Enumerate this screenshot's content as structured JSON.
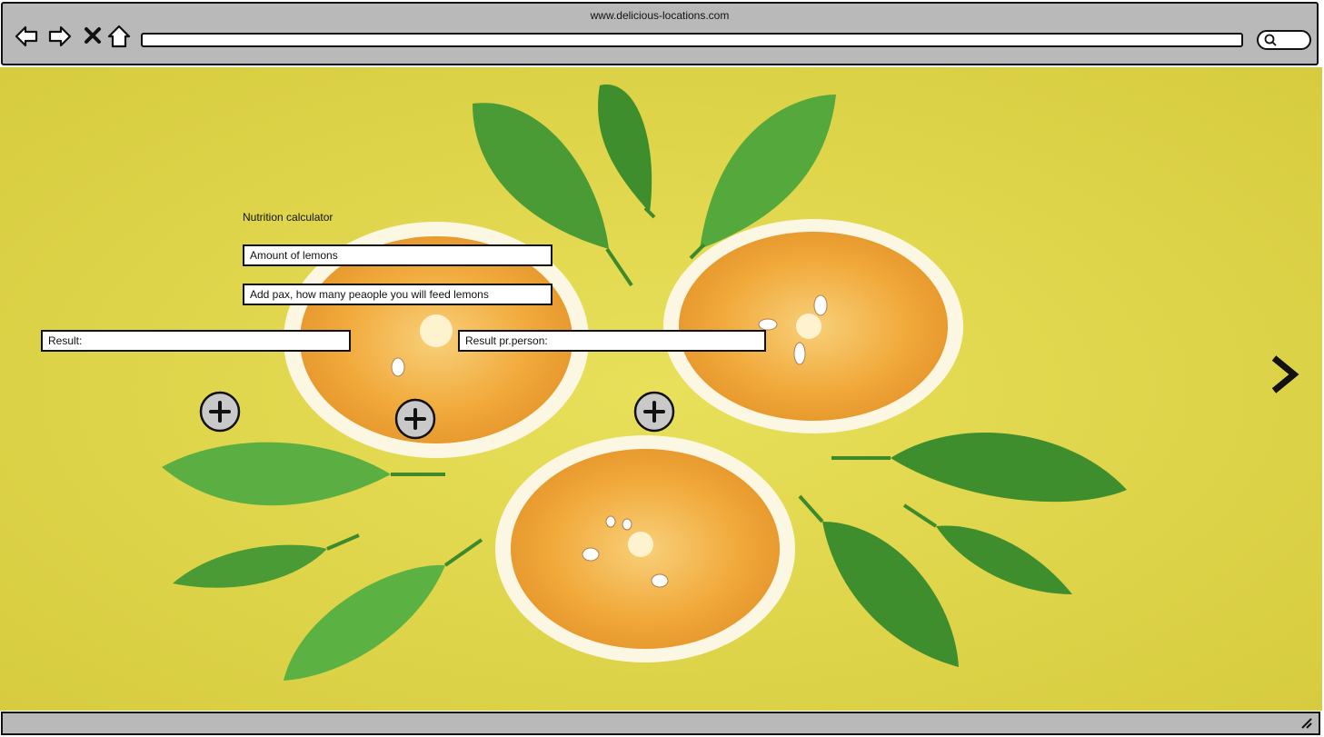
{
  "browser": {
    "url": "www.delicious-locations.com",
    "buttons": {
      "back_icon": "arrow-left-icon",
      "forward_icon": "arrow-right-icon",
      "stop_icon": "close-icon",
      "home_icon": "home-icon",
      "search_icon": "search-icon"
    }
  },
  "calculator": {
    "title": "Nutrition calculator",
    "amount_placeholder": "Amount of lemons",
    "pax_placeholder": "Add pax, how many peaople you will feed lemons",
    "result_label": "Result:",
    "result_per_person_label": "Result pr.person:"
  },
  "controls": {
    "add_icon": "plus-circle-icon",
    "next_icon": "chevron-right-icon",
    "resize_icon": "resize-grip-icon"
  },
  "colors": {
    "chrome_bg": "#b9b9b9",
    "content_bg": "#e2d84c",
    "leaf": "#4fa33a",
    "orange": "#f2a93a"
  }
}
